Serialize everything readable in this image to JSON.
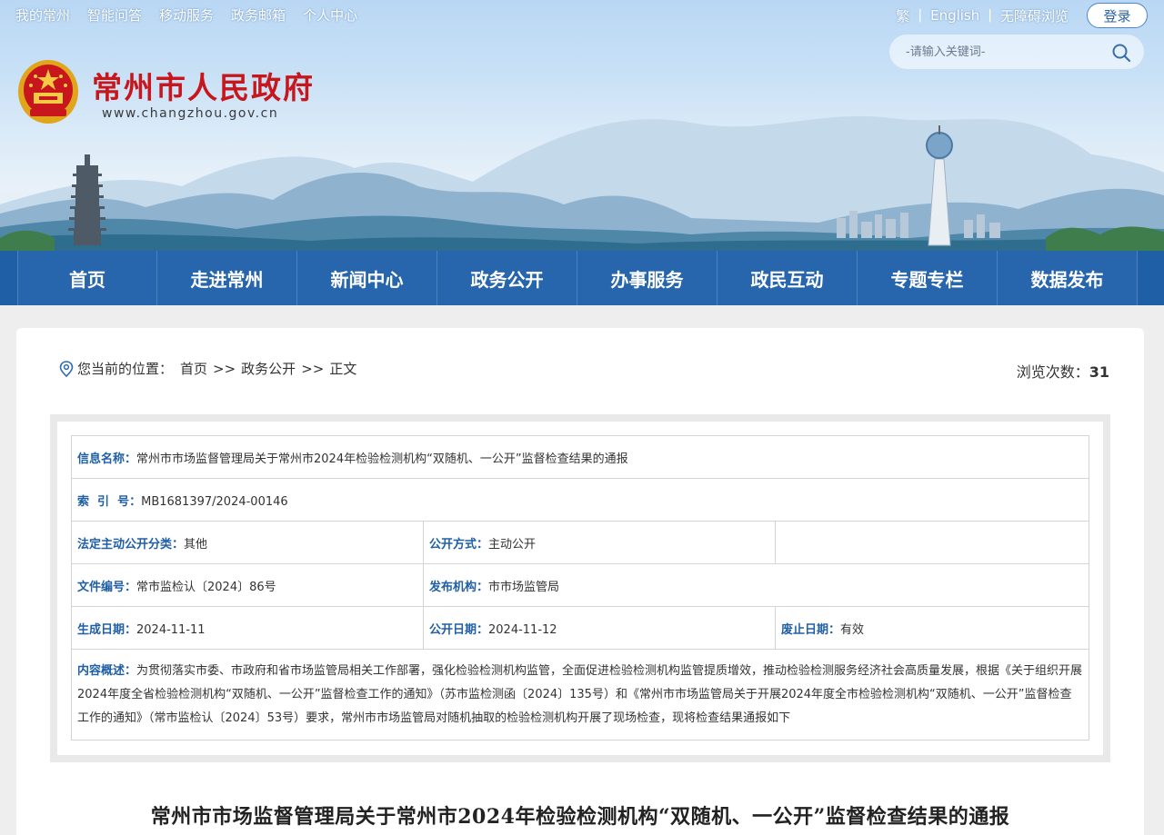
{
  "header": {
    "top_links": [
      "我的常州",
      "智能问答",
      "移动服务",
      "政务邮箱",
      "个人中心"
    ],
    "util_links": [
      "繁",
      "English",
      "无障碍浏览"
    ],
    "login_label": "登录",
    "search_placeholder": "-请输入关键词-",
    "site_title": "常州市人民政府",
    "site_url": "www.changzhou.gov.cn"
  },
  "nav": {
    "items": [
      "首页",
      "走进常州",
      "新闻中心",
      "政务公开",
      "办事服务",
      "政民互动",
      "专题专栏",
      "数据发布"
    ]
  },
  "breadcrumb": {
    "label": "您当前的位置：",
    "items": [
      "首页",
      "政务公开",
      "正文"
    ],
    "separator": ">>"
  },
  "views": {
    "label": "浏览次数：",
    "count": "31"
  },
  "meta": {
    "info_name_key": "信息名称：",
    "info_name": "常州市市场监督管理局关于常州市2024年检验检测机构“双随机、一公开”监督检查结果的通报",
    "index_key": "索  引  号：",
    "index": "MB1681397/2024-00146",
    "category_key": "法定主动公开分类：",
    "category": "其他",
    "method_key": "公开方式：",
    "method": "主动公开",
    "doc_no_key": "文件编号：",
    "doc_no": "常市监检认〔2024〕86号",
    "publisher_key": "发布机构：",
    "publisher": "市市场监管局",
    "created_key": "生成日期：",
    "created": "2024-11-11",
    "public_date_key": "公开日期：",
    "public_date": "2024-11-12",
    "expire_key": "废止日期：",
    "expire": "有效",
    "summary_key": "内容概述：",
    "summary": "为贯彻落实市委、市政府和省市场监管局相关工作部署，强化检验检测机构监管，全面促进检验检测机构监管提质增效，推动检验检测服务经济社会高质量发展，根据《关于组织开展2024年度全省检验检测机构“双随机、一公开”监督检查工作的通知》（苏市监检测函〔2024〕135号）和《常州市市场监管局关于开展2024年度全市检验检测机构“双随机、一公开”监督检查工作的通知》（常市监检认〔2024〕53号）要求，常州市市场监管局对随机抽取的检验检测机构开展了现场检查，现将检查结果通报如下"
  },
  "article": {
    "title": "常州市市场监督管理局关于常州市2024年检验检测机构“双随机、一公开”监督检查结果的通报"
  },
  "colors": {
    "nav_blue": "#2766ad",
    "title_red": "#c8161d",
    "key_blue": "#1f5fa6"
  }
}
